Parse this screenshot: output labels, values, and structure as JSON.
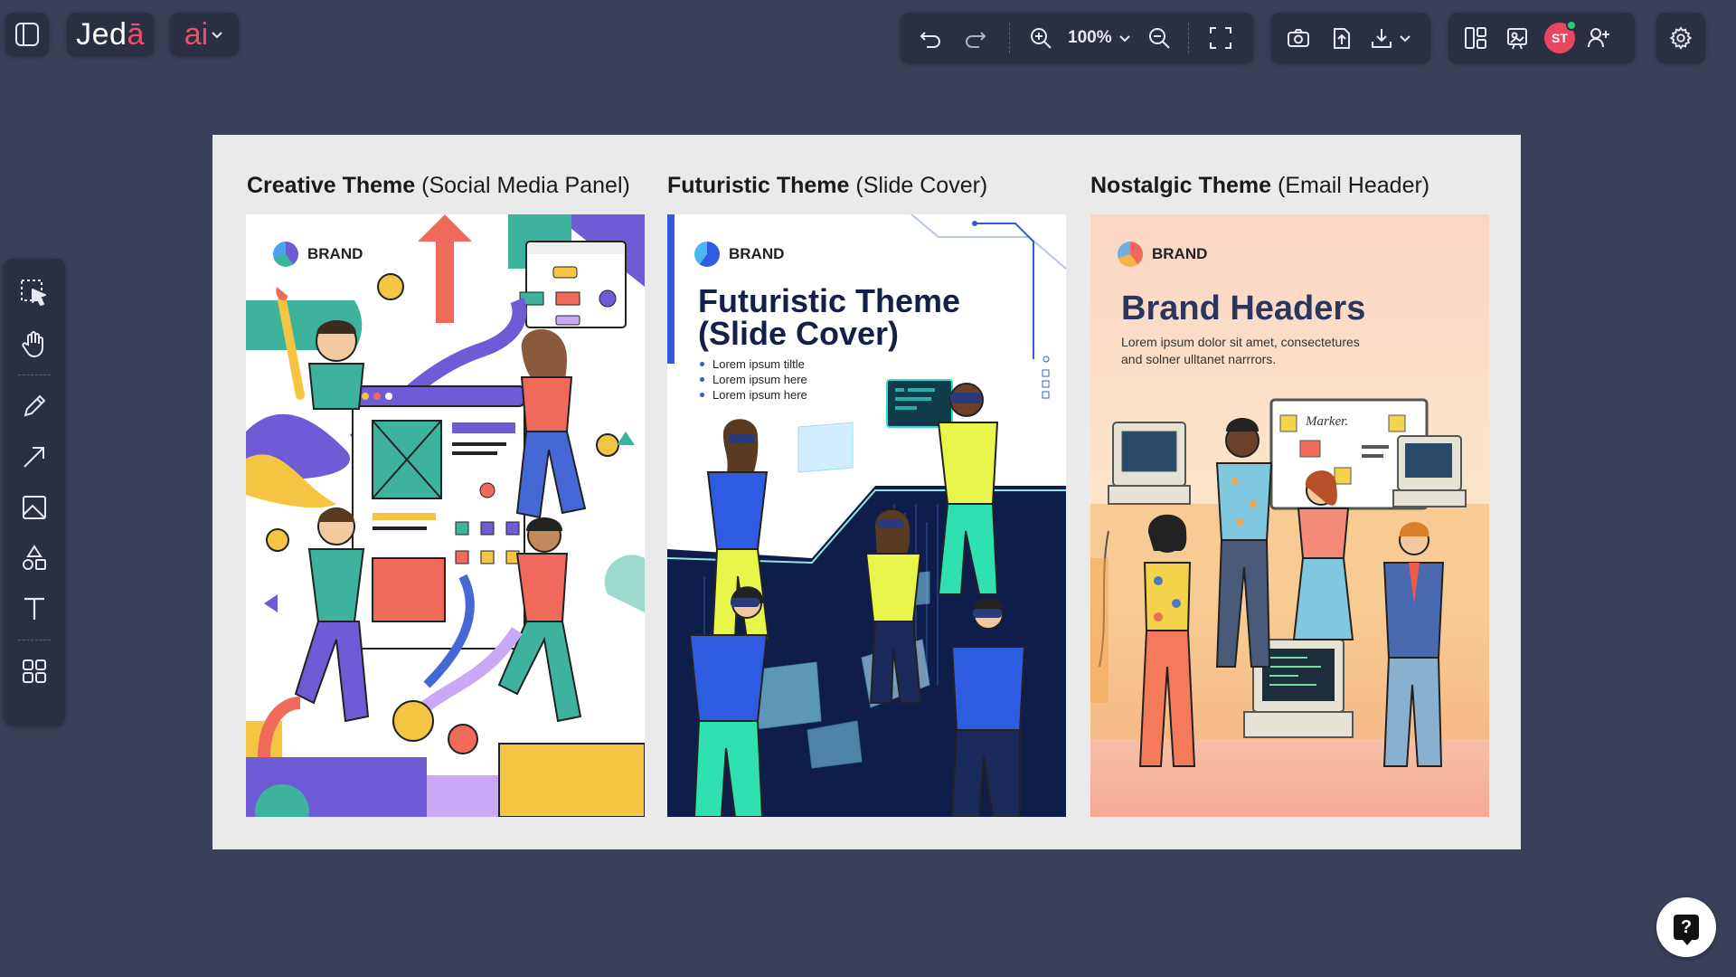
{
  "app": {
    "logo_text_main": "Jed",
    "logo_text_accent": "ā",
    "ai_label_main": "a",
    "ai_label_accent": "i"
  },
  "toolbar": {
    "zoom_level": "100%",
    "avatar_initials": "ST",
    "avatar_color": "#e8475f",
    "online_dot_color": "#2ecc71"
  },
  "left_tools": [
    {
      "name": "select-tool",
      "icon": "select-icon"
    },
    {
      "name": "hand-tool",
      "icon": "hand-icon"
    },
    {
      "name": "pencil-tool",
      "icon": "pencil-icon"
    },
    {
      "name": "arrow-tool",
      "icon": "arrow-icon"
    },
    {
      "name": "image-tool",
      "icon": "image-icon"
    },
    {
      "name": "shapes-tool",
      "icon": "shapes-icon"
    },
    {
      "name": "text-tool",
      "icon": "text-icon"
    },
    {
      "name": "grid-tool",
      "icon": "grid-icon"
    }
  ],
  "canvas": {
    "columns": [
      {
        "title_bold": "Creative Theme",
        "title_rest": "(Social Media Panel)",
        "brand": "BRAND"
      },
      {
        "title_bold": "Futuristic Theme",
        "title_rest": "(Slide Cover)",
        "brand": "BRAND",
        "heading_line1": "Futuristic Theme",
        "heading_line2": "(Slide Cover)",
        "bullets": [
          "Lorem ipsum tiltle",
          "Lorem ipsum here",
          "Lorem ipsum here"
        ]
      },
      {
        "title_bold": "Nostalgic Theme",
        "title_rest": "(Email Header)",
        "brand": "BRAND",
        "heading": "Brand Headers",
        "body_line1": "Lorem ipsum dolor sit amet, consectetures",
        "body_line2": "and solner ulltanet narrrors.",
        "whiteboard_text": "Marker."
      }
    ]
  },
  "help": {
    "label": "?"
  }
}
